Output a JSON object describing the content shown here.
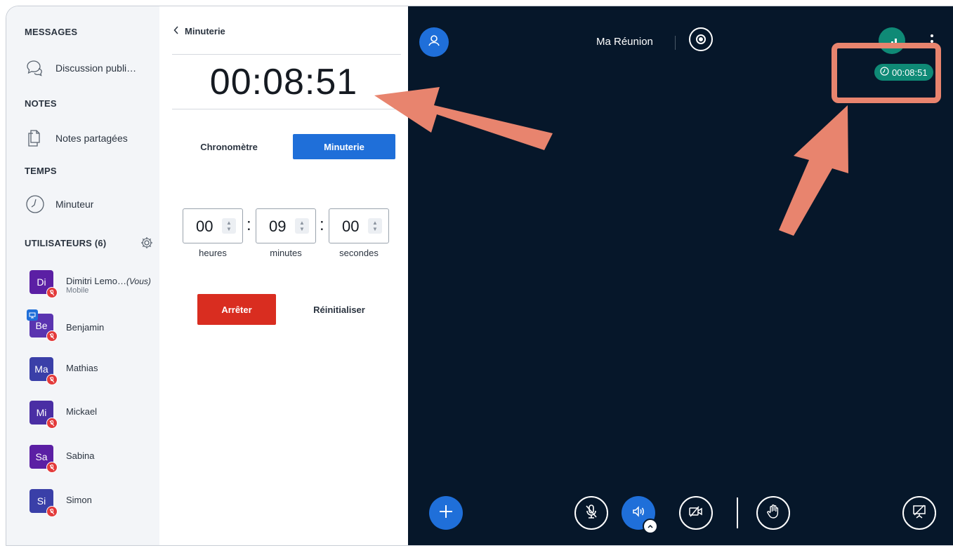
{
  "sidebar": {
    "messages_title": "MESSAGES",
    "discussion_label": "Discussion publi…",
    "notes_title": "NOTES",
    "shared_notes_label": "Notes partagées",
    "time_title": "TEMPS",
    "timer_label": "Minuteur",
    "users_title": "UTILISATEURS (6)",
    "users": [
      {
        "initials": "Di",
        "name": "Dimitri Lemo…",
        "you": "(Vous)",
        "sub": "Mobile",
        "color": "#5b1fa4"
      },
      {
        "initials": "Be",
        "name": "Benjamin",
        "color": "#5a34b0"
      },
      {
        "initials": "Ma",
        "name": "Mathias",
        "color": "#3a3fa8"
      },
      {
        "initials": "Mi",
        "name": "Mickael",
        "color": "#4a2ea4"
      },
      {
        "initials": "Sa",
        "name": "Sabina",
        "color": "#5b1fa4"
      },
      {
        "initials": "Si",
        "name": "Simon",
        "color": "#3a3fa8"
      }
    ]
  },
  "panel": {
    "back_label": "Minuterie",
    "display_time": "00:08:51",
    "tab_stopwatch": "Chronomètre",
    "tab_timer": "Minuterie",
    "hours": "00",
    "minutes": "09",
    "seconds": "00",
    "hours_label": "heures",
    "minutes_label": "minutes",
    "seconds_label": "secondes",
    "stop_label": "Arrêter",
    "reset_label": "Réinitialiser"
  },
  "main": {
    "meeting_name": "Ma Réunion",
    "timer_pill": "00:08:51"
  },
  "colors": {
    "accent_blue": "#1f6fd9",
    "stop_red": "#d92d20",
    "video_bg": "#06172a",
    "pill_green": "#0f8a76",
    "annotation": "#e8846e"
  }
}
